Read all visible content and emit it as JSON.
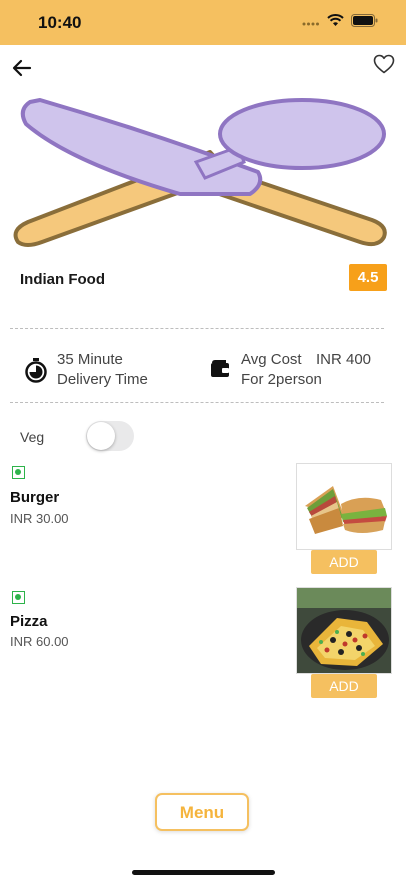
{
  "status_bar": {
    "time": "10:40"
  },
  "header": {
    "back_icon": "arrow-left-icon",
    "favorite_icon": "heart-outline-icon"
  },
  "restaurant": {
    "name": "Indian Food",
    "rating": "4.5"
  },
  "info": {
    "delivery_time": "35 Minute",
    "delivery_label": "Delivery Time",
    "avg_cost_label": "Avg Cost",
    "avg_cost_value": "INR 400",
    "for_persons": "For 2person"
  },
  "filter": {
    "veg_label": "Veg",
    "veg_toggle_on": false
  },
  "items": [
    {
      "name": "Burger",
      "price": "INR 30.00",
      "add_label": "ADD",
      "veg": true
    },
    {
      "name": "Pizza",
      "price": "INR 60.00",
      "add_label": "ADD",
      "veg": true
    }
  ],
  "footer": {
    "menu_label": "Menu"
  },
  "colors": {
    "accent": "#f5c060",
    "rating_bg": "#f7a01a",
    "veg_green": "#2db34a"
  }
}
